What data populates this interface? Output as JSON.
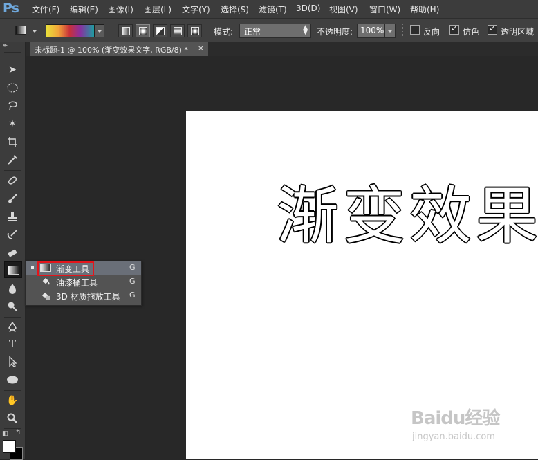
{
  "app": {
    "logo": "Ps"
  },
  "menu": [
    "文件(F)",
    "编辑(E)",
    "图像(I)",
    "图层(L)",
    "文字(Y)",
    "选择(S)",
    "滤镜(T)",
    "3D(D)",
    "视图(V)",
    "窗口(W)",
    "帮助(H)"
  ],
  "options": {
    "mode_label": "模式:",
    "mode_value": "正常",
    "opacity_label": "不透明度:",
    "opacity_value": "100%",
    "reverse_label": "反向",
    "reverse_checked": false,
    "dither_label": "仿色",
    "dither_checked": true,
    "transparency_label": "透明区域",
    "transparency_checked": true
  },
  "document": {
    "tab_title": "未标题-1 @ 100% (渐变效果文字, RGB/8) *",
    "close_glyph": "×",
    "canvas_text": "渐变效果"
  },
  "toolbar": {
    "tools": [
      "move-tool",
      "marquee-tool",
      "lasso-tool",
      "magic-wand-tool",
      "crop-tool",
      "eyedropper-tool",
      "healing-brush-tool",
      "brush-tool",
      "clone-stamp-tool",
      "history-brush-tool",
      "eraser-tool",
      "gradient-tool",
      "blur-tool",
      "dodge-tool",
      "pen-tool",
      "type-tool",
      "path-selection-tool",
      "ellipse-tool",
      "hand-tool",
      "zoom-tool"
    ],
    "selected": "gradient-tool"
  },
  "flyout": {
    "items": [
      {
        "label": "渐变工具",
        "key": "G",
        "icon": "gradient-icon"
      },
      {
        "label": "油漆桶工具",
        "key": "G",
        "icon": "paint-bucket-icon"
      },
      {
        "label": "3D 材质拖放工具",
        "key": "G",
        "icon": "3d-material-drop-icon"
      }
    ]
  },
  "watermark": {
    "logo": "Baidu经验",
    "url": "jingyan.baidu.com"
  },
  "colors": {
    "accent_outline": "#e3151b",
    "foreground": "#ffffff",
    "background": "#000000"
  }
}
